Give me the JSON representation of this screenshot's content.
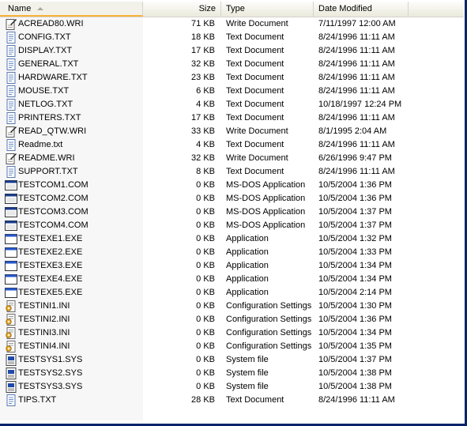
{
  "columns": {
    "name": "Name",
    "size": "Size",
    "type": "Type",
    "date": "Date Modified"
  },
  "files": [
    {
      "name": "ACREAD80.WRI",
      "size": "71 KB",
      "type": "Write Document",
      "date": "7/11/1997 12:00 AM",
      "icon": "write-document-icon"
    },
    {
      "name": "CONFIG.TXT",
      "size": "18 KB",
      "type": "Text Document",
      "date": "8/24/1996 11:11 AM",
      "icon": "text-document-icon"
    },
    {
      "name": "DISPLAY.TXT",
      "size": "17 KB",
      "type": "Text Document",
      "date": "8/24/1996 11:11 AM",
      "icon": "text-document-icon"
    },
    {
      "name": "GENERAL.TXT",
      "size": "32 KB",
      "type": "Text Document",
      "date": "8/24/1996 11:11 AM",
      "icon": "text-document-icon"
    },
    {
      "name": "HARDWARE.TXT",
      "size": "23 KB",
      "type": "Text Document",
      "date": "8/24/1996 11:11 AM",
      "icon": "text-document-icon"
    },
    {
      "name": "MOUSE.TXT",
      "size": "6 KB",
      "type": "Text Document",
      "date": "8/24/1996 11:11 AM",
      "icon": "text-document-icon"
    },
    {
      "name": "NETLOG.TXT",
      "size": "4 KB",
      "type": "Text Document",
      "date": "10/18/1997 12:24 PM",
      "icon": "text-document-icon"
    },
    {
      "name": "PRINTERS.TXT",
      "size": "17 KB",
      "type": "Text Document",
      "date": "8/24/1996 11:11 AM",
      "icon": "text-document-icon"
    },
    {
      "name": "READ_QTW.WRI",
      "size": "33 KB",
      "type": "Write Document",
      "date": "8/1/1995 2:04 AM",
      "icon": "write-document-icon"
    },
    {
      "name": "Readme.txt",
      "size": "4 KB",
      "type": "Text Document",
      "date": "8/24/1996 11:11 AM",
      "icon": "text-document-icon"
    },
    {
      "name": "README.WRI",
      "size": "32 KB",
      "type": "Write Document",
      "date": "6/26/1996 9:47 PM",
      "icon": "write-document-icon"
    },
    {
      "name": "SUPPORT.TXT",
      "size": "8 KB",
      "type": "Text Document",
      "date": "8/24/1996 11:11 AM",
      "icon": "text-document-icon"
    },
    {
      "name": "TESTCOM1.COM",
      "size": "0 KB",
      "type": "MS-DOS Application",
      "date": "10/5/2004 1:36 PM",
      "icon": "msdos-application-icon"
    },
    {
      "name": "TESTCOM2.COM",
      "size": "0 KB",
      "type": "MS-DOS Application",
      "date": "10/5/2004 1:36 PM",
      "icon": "msdos-application-icon"
    },
    {
      "name": "TESTCOM3.COM",
      "size": "0 KB",
      "type": "MS-DOS Application",
      "date": "10/5/2004 1:37 PM",
      "icon": "msdos-application-icon"
    },
    {
      "name": "TESTCOM4.COM",
      "size": "0 KB",
      "type": "MS-DOS Application",
      "date": "10/5/2004 1:37 PM",
      "icon": "msdos-application-icon"
    },
    {
      "name": "TESTEXE1.EXE",
      "size": "0 KB",
      "type": "Application",
      "date": "10/5/2004 1:32 PM",
      "icon": "application-icon"
    },
    {
      "name": "TESTEXE2.EXE",
      "size": "0 KB",
      "type": "Application",
      "date": "10/5/2004 1:33 PM",
      "icon": "application-icon"
    },
    {
      "name": "TESTEXE3.EXE",
      "size": "0 KB",
      "type": "Application",
      "date": "10/5/2004 1:34 PM",
      "icon": "application-icon"
    },
    {
      "name": "TESTEXE4.EXE",
      "size": "0 KB",
      "type": "Application",
      "date": "10/5/2004 1:34 PM",
      "icon": "application-icon"
    },
    {
      "name": "TESTEXE5.EXE",
      "size": "0 KB",
      "type": "Application",
      "date": "10/5/2004 2:14 PM",
      "icon": "application-icon"
    },
    {
      "name": "TESTINI1.INI",
      "size": "0 KB",
      "type": "Configuration Settings",
      "date": "10/5/2004 1:30 PM",
      "icon": "configuration-settings-icon"
    },
    {
      "name": "TESTINI2.INI",
      "size": "0 KB",
      "type": "Configuration Settings",
      "date": "10/5/2004 1:36 PM",
      "icon": "configuration-settings-icon"
    },
    {
      "name": "TESTINI3.INI",
      "size": "0 KB",
      "type": "Configuration Settings",
      "date": "10/5/2004 1:34 PM",
      "icon": "configuration-settings-icon"
    },
    {
      "name": "TESTINI4.INI",
      "size": "0 KB",
      "type": "Configuration Settings",
      "date": "10/5/2004 1:35 PM",
      "icon": "configuration-settings-icon"
    },
    {
      "name": "TESTSYS1.SYS",
      "size": "0 KB",
      "type": "System file",
      "date": "10/5/2004 1:37 PM",
      "icon": "system-file-icon"
    },
    {
      "name": "TESTSYS2.SYS",
      "size": "0 KB",
      "type": "System file",
      "date": "10/5/2004 1:38 PM",
      "icon": "system-file-icon"
    },
    {
      "name": "TESTSYS3.SYS",
      "size": "0 KB",
      "type": "System file",
      "date": "10/5/2004 1:38 PM",
      "icon": "system-file-icon"
    },
    {
      "name": "TIPS.TXT",
      "size": "28 KB",
      "type": "Text Document",
      "date": "8/24/1996 11:11 AM",
      "icon": "text-document-icon"
    }
  ],
  "colors": {
    "selection_border": "#0a246a",
    "header_sort_accent": "#f8b33a"
  }
}
